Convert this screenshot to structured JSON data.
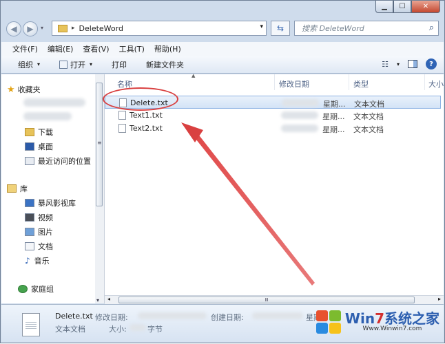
{
  "window": {
    "caption_buttons": {
      "minimize": "▁",
      "maximize": "☐",
      "close": "✕"
    }
  },
  "address": {
    "path_separator": "▸",
    "path": "DeleteWord",
    "dropdown": "▾",
    "refresh_icon": "⇆",
    "search_placeholder": "搜索 DeleteWord",
    "search_icon": "⌕"
  },
  "menu": {
    "items": [
      "文件(F)",
      "编辑(E)",
      "查看(V)",
      "工具(T)",
      "帮助(H)"
    ]
  },
  "toolbar": {
    "organize": "组织",
    "open": "打开",
    "print": "打印",
    "new_folder": "新建文件夹",
    "help": "?",
    "dropdown": "▾",
    "view_icon": "☷"
  },
  "nav": {
    "favorites": "收藏夹",
    "downloads": "下载",
    "desktop": "桌面",
    "recent": "最近访问的位置",
    "libraries": "库",
    "baofeng": "暴风影视库",
    "videos": "视频",
    "pictures": "图片",
    "documents": "文档",
    "music": "音乐",
    "homegroup": "家庭组",
    "scroll_down": "▾",
    "arrow_collapsed": "▸"
  },
  "columns": {
    "name": "名称",
    "modified": "修改日期",
    "type": "类型",
    "size": "大小"
  },
  "files": [
    {
      "name": "Delete.txt",
      "date_suffix": "星期...",
      "type": "文本文档"
    },
    {
      "name": "Text1.txt",
      "date_suffix": "星期...",
      "type": "文本文档"
    },
    {
      "name": "Text2.txt",
      "date_suffix": "星期...",
      "type": "文本文档"
    }
  ],
  "details": {
    "filename": "Delete.txt",
    "modified_label": "修改日期:",
    "created_label": "创建日期:",
    "created_suffix": "星期...",
    "type": "文本文档",
    "size_label": "大小:",
    "size_unit": "字节"
  },
  "hscroll": {
    "grip": "Ⅲ",
    "left_arrow": "◂",
    "right_arrow": "▸"
  },
  "watermark": {
    "brand_a": "Win",
    "brand_num": "7",
    "brand_b": "系统之家",
    "url": "Www.Winwin7.com"
  },
  "colors": {
    "annotation_red": "#d94040",
    "selection_bg": "#d3e3f6",
    "window_chrome": "#cfdcec"
  }
}
